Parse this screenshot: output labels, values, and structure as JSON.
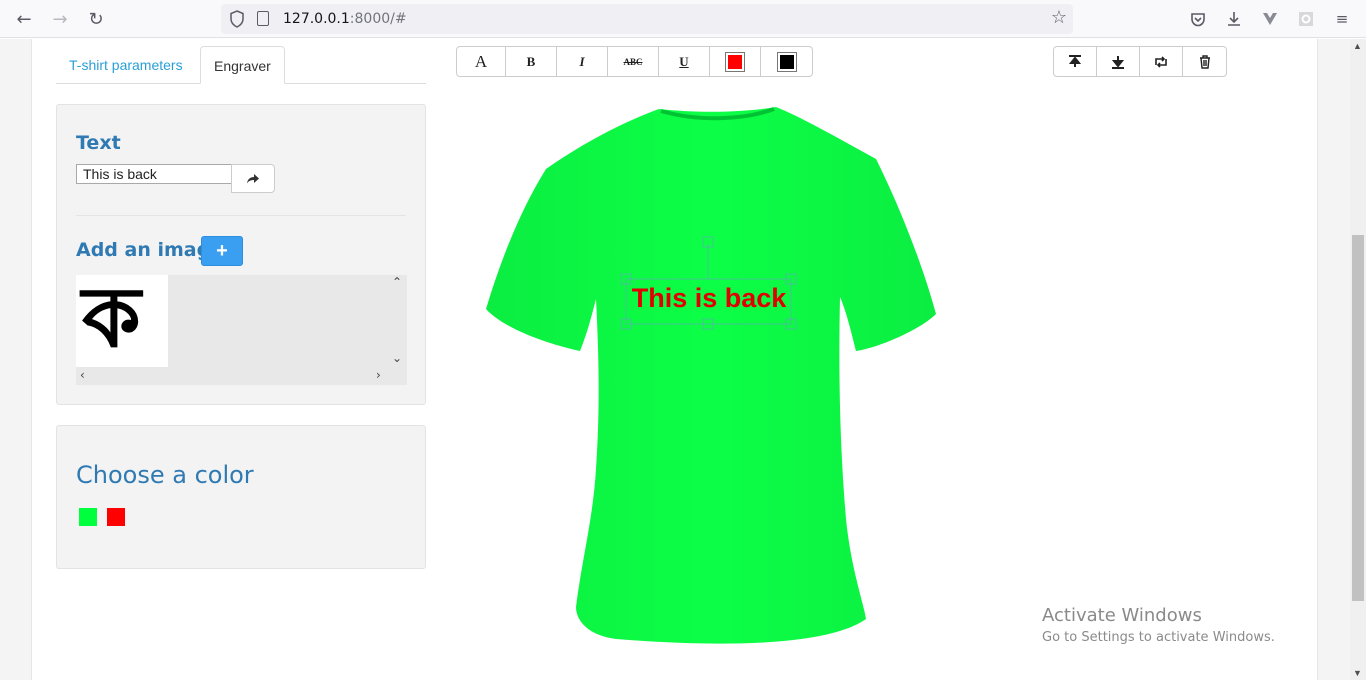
{
  "browser": {
    "url_host": "127.0.0.1",
    "url_rest": ":8000/#"
  },
  "tabs": [
    {
      "label": "T-shirt parameters",
      "active": false
    },
    {
      "label": "Engraver",
      "active": true
    }
  ],
  "text_panel": {
    "title": "Text",
    "input_value": "This is back"
  },
  "image_panel": {
    "title": "Add an image",
    "add_button": "+",
    "thumbnail_glyph": "ক"
  },
  "color_panel": {
    "title": "Choose a color",
    "swatches": [
      "#00ff3c",
      "#ff0000"
    ]
  },
  "toolbar": {
    "font_label": "A",
    "bold_label": "B",
    "italic_label": "I",
    "strike_label": "ABC",
    "underline_label": "U",
    "fill_color": "#ff0000",
    "stroke_color": "#000000"
  },
  "canvas": {
    "shirt_color": "#0cff46",
    "engraved_text": "This is back",
    "text_color": "#e00000"
  },
  "watermark": {
    "line1": "Activate Windows",
    "line2": "Go to Settings to activate Windows."
  }
}
